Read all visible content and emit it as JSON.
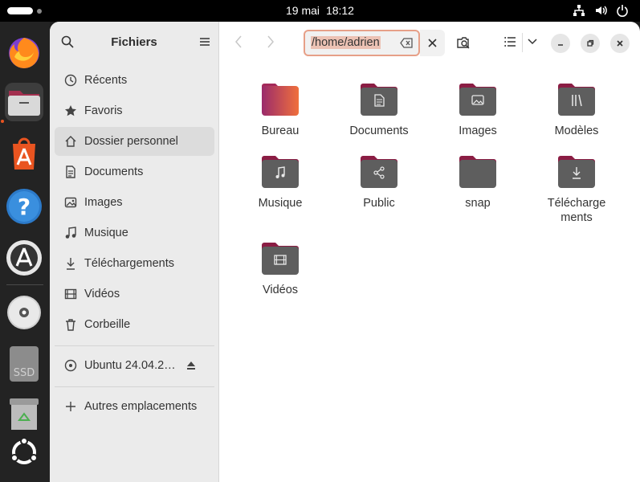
{
  "topbar": {
    "date": "19 mai",
    "time": "18:12"
  },
  "dock": {
    "items": [
      {
        "name": "firefox-icon"
      },
      {
        "name": "files-icon"
      },
      {
        "name": "app-center-icon"
      },
      {
        "name": "help-icon"
      },
      {
        "name": "software-updater-icon"
      },
      {
        "name": "disc-icon"
      },
      {
        "name": "ssd-icon",
        "label": "SSD"
      },
      {
        "name": "trash-icon"
      },
      {
        "name": "show-apps-icon"
      }
    ]
  },
  "sidebar": {
    "title": "Fichiers",
    "items": [
      {
        "label": "Récents",
        "icon": "clock-icon"
      },
      {
        "label": "Favoris",
        "icon": "star-icon"
      },
      {
        "label": "Dossier personnel",
        "icon": "home-icon"
      },
      {
        "label": "Documents",
        "icon": "document-icon"
      },
      {
        "label": "Images",
        "icon": "image-icon"
      },
      {
        "label": "Musique",
        "icon": "music-icon"
      },
      {
        "label": "Téléchargements",
        "icon": "download-icon"
      },
      {
        "label": "Vidéos",
        "icon": "video-icon"
      },
      {
        "label": "Corbeille",
        "icon": "trash-icon"
      }
    ],
    "volume": "Ubuntu 24.04.2…",
    "other_locations": "Autres emplacements"
  },
  "header": {
    "path": "/home/adrien"
  },
  "files": [
    {
      "label": "Bureau",
      "type": "desktop"
    },
    {
      "label": "Documents",
      "type": "documents"
    },
    {
      "label": "Images",
      "type": "images"
    },
    {
      "label": "Modèles",
      "type": "templates"
    },
    {
      "label": "Musique",
      "type": "music"
    },
    {
      "label": "Public",
      "type": "public"
    },
    {
      "label": "snap",
      "type": "plain"
    },
    {
      "label": "Télécharge\nments",
      "type": "downloads"
    },
    {
      "label": "Vidéos",
      "type": "videos"
    }
  ],
  "colors": {
    "accent": "#e95420",
    "folder_tab": "#8b1d44",
    "folder_body": "#5e5e5e"
  }
}
